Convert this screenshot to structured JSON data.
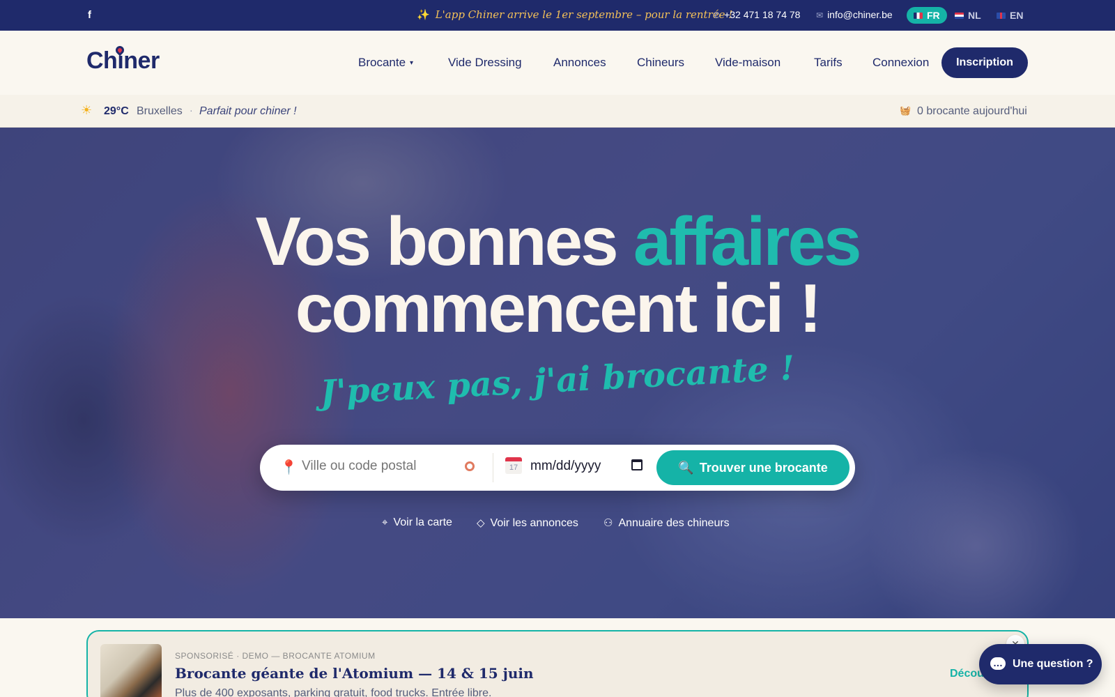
{
  "topbar": {
    "social_icon": "facebook-icon",
    "announcement": "L'app Chiner arrive le 1er septembre – pour la rentrée !",
    "phone": "+32 471 18 74 78",
    "email": "info@chiner.be",
    "languages": [
      {
        "code": "FR",
        "active": true
      },
      {
        "code": "NL",
        "active": false
      },
      {
        "code": "EN",
        "active": false
      }
    ]
  },
  "header": {
    "logo": "Chiner",
    "nav": [
      {
        "label": "Brocante",
        "has_dropdown": true
      },
      {
        "label": "Vide Dressing"
      },
      {
        "label": "Annonces"
      },
      {
        "label": "Chineurs"
      },
      {
        "label": "Vide-maison"
      },
      {
        "label": "Tarifs"
      },
      {
        "label": "Connexion"
      }
    ],
    "cta": "Inscription"
  },
  "weather": {
    "temp": "29°C",
    "city": "Bruxelles",
    "separator": "·",
    "tip": "Parfait pour chiner !",
    "today_count": "0 brocante aujourd'hui"
  },
  "hero": {
    "title_part1": "Vos bonnes",
    "title_accent": "affaires",
    "title_part2": "commencent ici !",
    "slogan": "J'peux pas, j'ai brocante !",
    "search": {
      "city_placeholder": "Ville ou code postal",
      "date_value": "mm/dd/yyyy",
      "button": "Trouver une brocante"
    },
    "quick_links": {
      "map": "Voir la carte",
      "annonces": "Voir les annonces",
      "annuaire": "Annuaire des chineurs"
    }
  },
  "sponsored": {
    "meta": "SPONSORISÉ · DEMO — BROCANTE ATOMIUM",
    "title": "Brocante géante de l'Atomium — 14 & 15 juin",
    "description": "Plus de 400 exposants, parking gratuit, food trucks. Entrée libre.",
    "link": "Décou"
  },
  "chat": {
    "label": "Une question ?"
  },
  "colors": {
    "navy": "#1f2a6b",
    "teal": "#15b3a7",
    "cream": "#faf7f0",
    "gold": "#f4c158"
  }
}
